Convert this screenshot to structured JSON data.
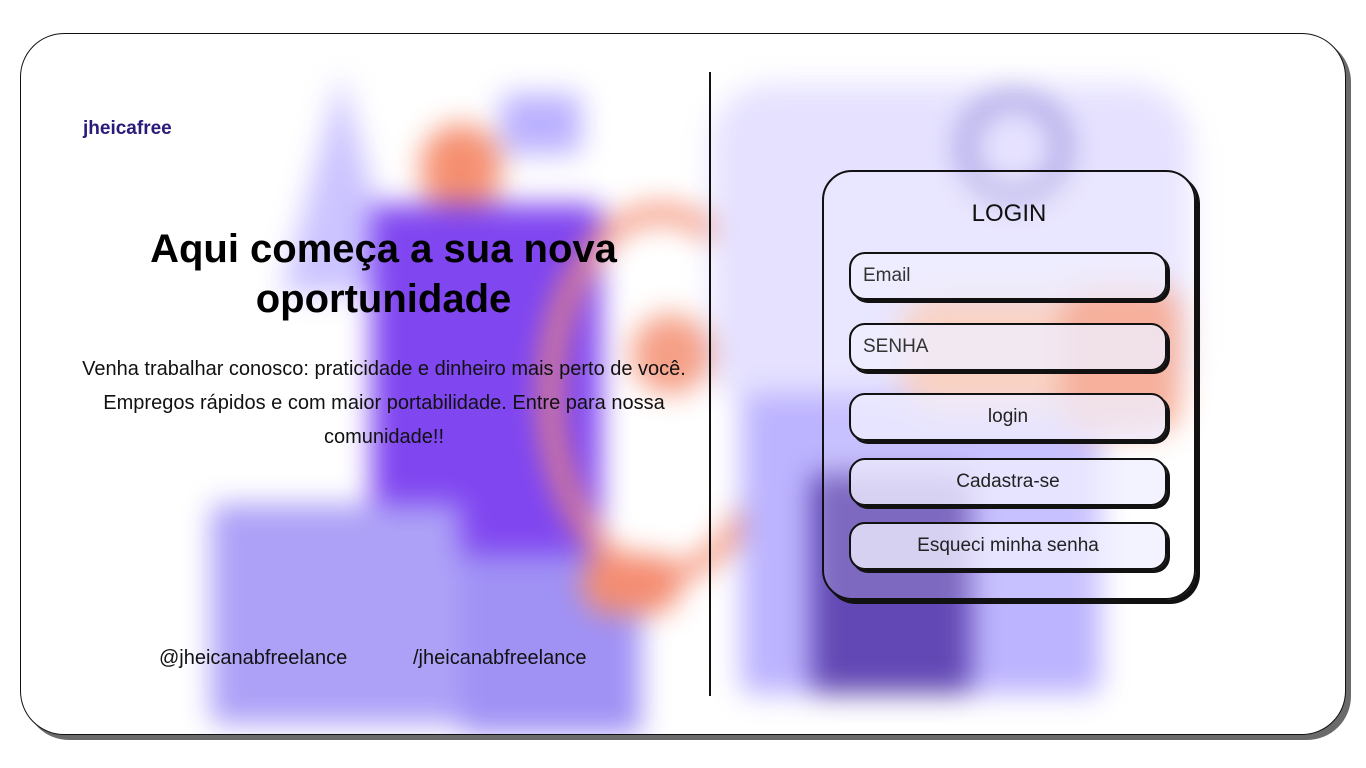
{
  "brand": {
    "name": "jheicafree",
    "color": "#2a1a7a"
  },
  "hero": {
    "headline": "Aqui começa a sua nova oportunidade",
    "description": "Venha trabalhar conosco: praticidade e dinheiro mais perto de você. Empregos rápidos e com maior portabilidade. Entre para nossa comunidade!!"
  },
  "social": {
    "instagram": "@jheicanabfreelance",
    "facebook": "/jheicanabfreelance"
  },
  "login": {
    "title": "LOGIN",
    "email_placeholder": "Email",
    "password_placeholder": "SENHA",
    "login_button": "login",
    "signup_button": "Cadastra-se",
    "forgot_button": "Esqueci minha senha"
  },
  "colors": {
    "accent_purple": "#7a4df0",
    "accent_coral": "#f47a5c",
    "lavender": "#d9d2ff"
  }
}
